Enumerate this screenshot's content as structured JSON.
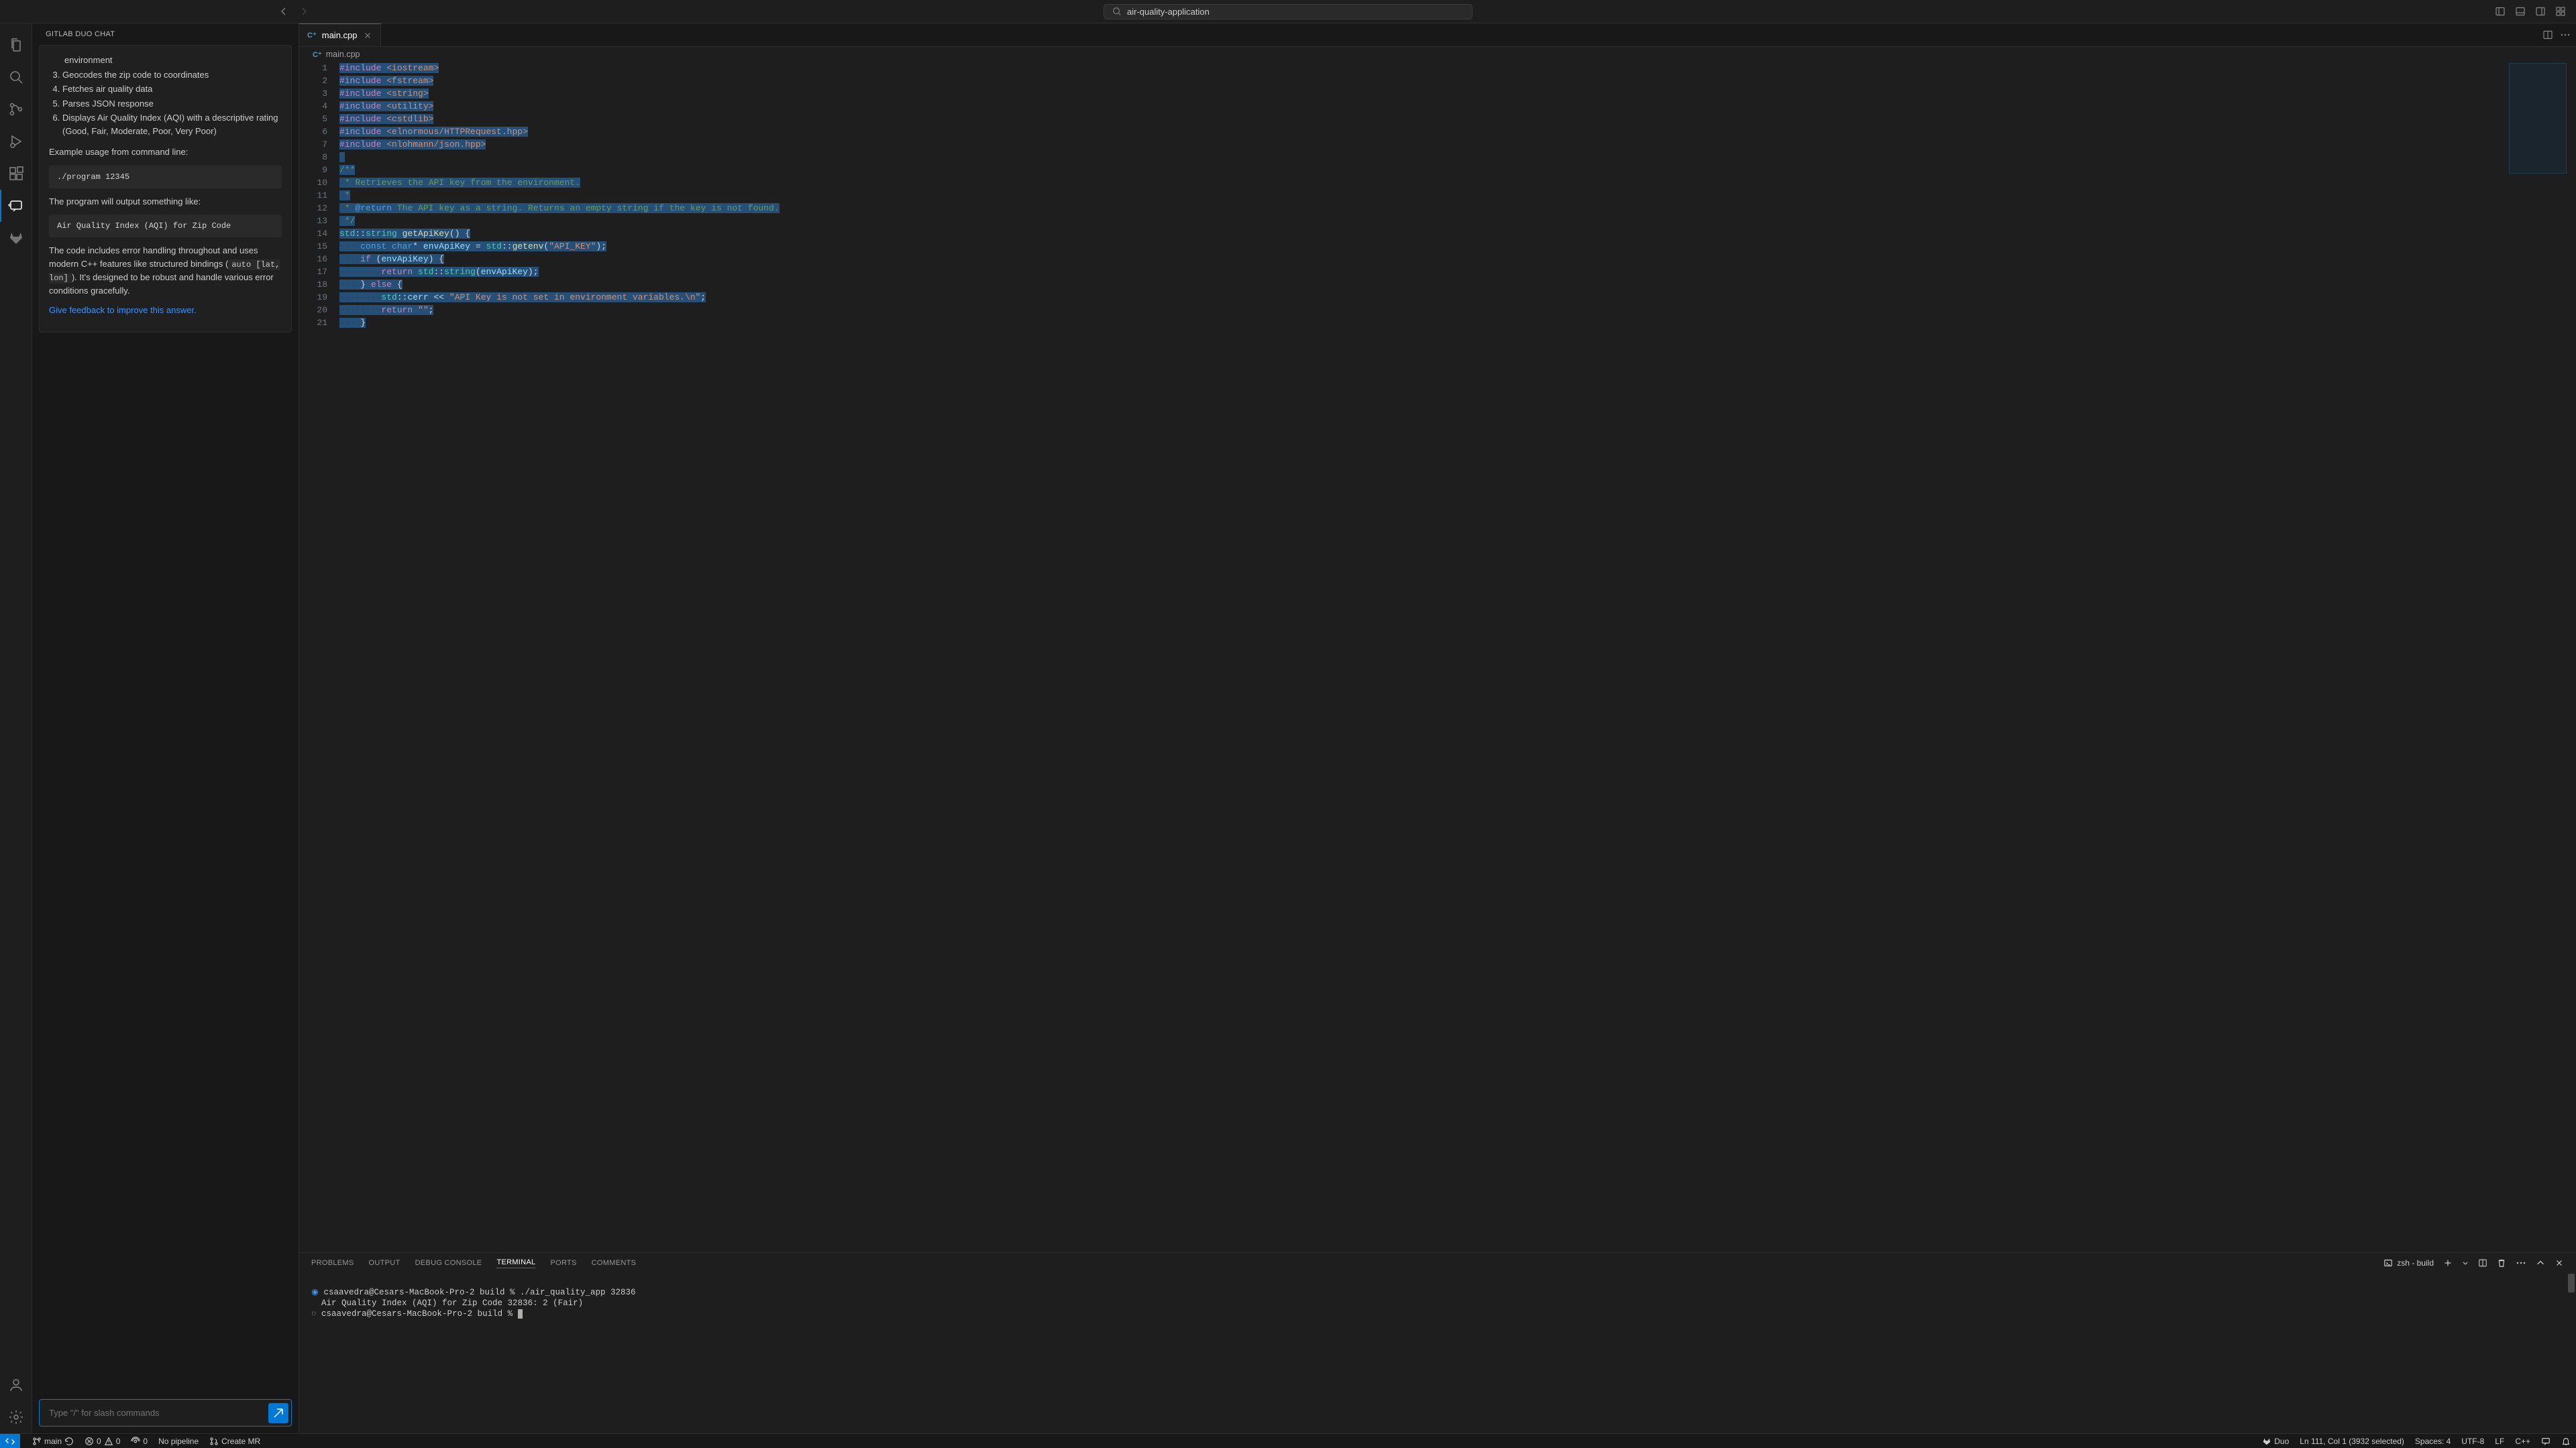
{
  "titlebar": {
    "search_text": "air-quality-application"
  },
  "side_panel": {
    "title": "GITLAB DUO CHAT",
    "chat": {
      "list_items": [
        "environment",
        "Geocodes the zip code to coordinates",
        "Fetches air quality data",
        "Parses JSON response",
        "Displays Air Quality Index (AQI) with a descriptive rating (Good, Fair, Moderate, Poor, Very Poor)"
      ],
      "list_start": 3,
      "example_label": "Example usage from command line:",
      "example_code": "./program 12345",
      "output_label": "The program will output something like:",
      "output_code": "Air Quality Index (AQI) for Zip Code",
      "footer_para_1": "The code includes error handling throughout and uses modern C++ features like structured bindings (",
      "footer_code": "auto [lat, lon]",
      "footer_para_2": "). It's designed to be robust and handle various error conditions gracefully.",
      "feedback_link": "Give feedback to improve this answer."
    },
    "input_placeholder": "Type \"/\" for slash commands"
  },
  "editor": {
    "tab": {
      "filename": "main.cpp"
    },
    "breadcrumb": "main.cpp",
    "line_count": 21
  },
  "panel": {
    "tabs": [
      "PROBLEMS",
      "OUTPUT",
      "DEBUG CONSOLE",
      "TERMINAL",
      "PORTS",
      "COMMENTS"
    ],
    "active_tab": "TERMINAL",
    "terminal_label": "zsh - build",
    "terminal_lines": [
      "csaavedra@Cesars-MacBook-Pro-2 build % ./air_quality_app 32836",
      "Air Quality Index (AQI) for Zip Code 32836: 2 (Fair)",
      "csaavedra@Cesars-MacBook-Pro-2 build % "
    ]
  },
  "statusbar": {
    "branch": "main",
    "errors": "0",
    "warnings": "0",
    "ports": "0",
    "pipeline": "No pipeline",
    "create_mr": "Create MR",
    "duo": "Duo",
    "cursor": "Ln 111, Col 1 (3932 selected)",
    "spaces": "Spaces: 4",
    "encoding": "UTF-8",
    "eol": "LF",
    "lang": "C++"
  }
}
